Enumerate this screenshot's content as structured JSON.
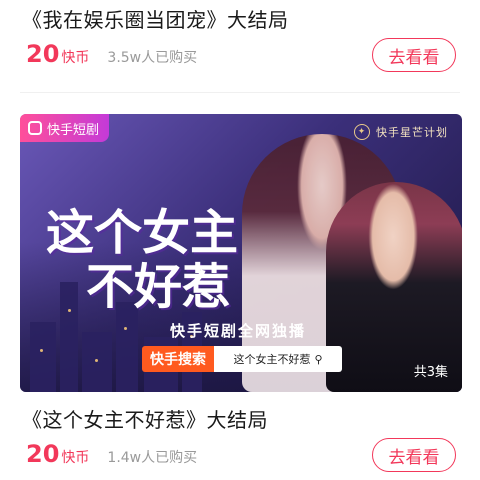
{
  "card1": {
    "title": "《我在娱乐圈当团宠》大结局",
    "price": "20",
    "price_unit": "快币",
    "sold": "3.5w人已购买",
    "watch_label": "去看看"
  },
  "banner": {
    "brand_badge": "快手短剧",
    "star_plan": "快手星芒计划",
    "show_title_line1": "这个女主",
    "show_title_line2": "不好惹",
    "exclusive": "快手短剧全网独播",
    "search_tag": "快手搜索",
    "search_query": "这个女主不好惹",
    "episodes": "共3集",
    "icons": {
      "brand": "kuaishou-logo-icon",
      "search": "search-icon",
      "seal": "star-plan-seal-icon"
    }
  },
  "card2": {
    "title": "《这个女主不好惹》大结局",
    "price": "20",
    "price_unit": "快币",
    "sold": "1.4w人已购买",
    "watch_label": "去看看"
  },
  "colors": {
    "accent": "#f2385a",
    "search_orange": "#ff5a1f"
  }
}
